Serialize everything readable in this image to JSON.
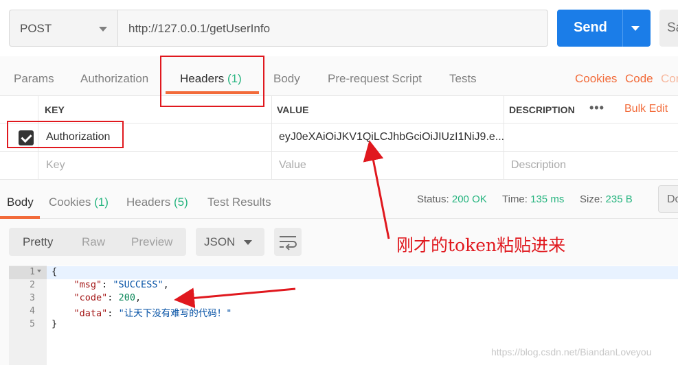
{
  "request": {
    "method": "POST",
    "url": "http://127.0.0.1/getUserInfo",
    "send_label": "Send",
    "save_label": "Sa"
  },
  "request_tabs": {
    "params": "Params",
    "authorization": "Authorization",
    "headers": "Headers",
    "headers_count": "(1)",
    "body": "Body",
    "prerequest": "Pre-request Script",
    "tests": "Tests",
    "cookies": "Cookies",
    "code": "Code",
    "comments": "Cor"
  },
  "headers_table": {
    "col_key": "KEY",
    "col_value": "VALUE",
    "col_description": "DESCRIPTION",
    "more": "•••",
    "bulk_edit": "Bulk Edit",
    "rows": [
      {
        "checked": true,
        "key": "Authorization",
        "value": "eyJ0eXAiOiJKV1QiLCJhbGciOiJIUzI1NiJ9.e..."
      }
    ],
    "placeholder_key": "Key",
    "placeholder_value": "Value",
    "placeholder_description": "Description"
  },
  "response_tabs": {
    "body": "Body",
    "cookies": "Cookies",
    "cookies_count": "(1)",
    "headers": "Headers",
    "headers_count": "(5)",
    "test_results": "Test Results"
  },
  "status": {
    "status_label": "Status:",
    "status_value": "200 OK",
    "time_label": "Time:",
    "time_value": "135 ms",
    "size_label": "Size:",
    "size_value": "235 B",
    "download_label": "Do"
  },
  "format": {
    "pretty": "Pretty",
    "raw": "Raw",
    "preview": "Preview",
    "language": "JSON"
  },
  "editor": {
    "line_numbers": [
      "1",
      "2",
      "3",
      "4",
      "5"
    ],
    "open_brace": "{",
    "close_brace": "}",
    "msg_key": "\"msg\"",
    "msg_value": "\"SUCCESS\"",
    "code_key": "\"code\"",
    "code_value": "200",
    "data_key": "\"data\"",
    "data_value": "\"让天下没有难写的代码！\""
  },
  "annotation": {
    "text": "刚才的token粘贴进来",
    "color": "#e0181e"
  },
  "watermark": "https://blog.csdn.net/BiandanLoveyou",
  "colors": {
    "accent": "#f26b3a",
    "send": "#1b7de8",
    "success": "#26b47f"
  }
}
